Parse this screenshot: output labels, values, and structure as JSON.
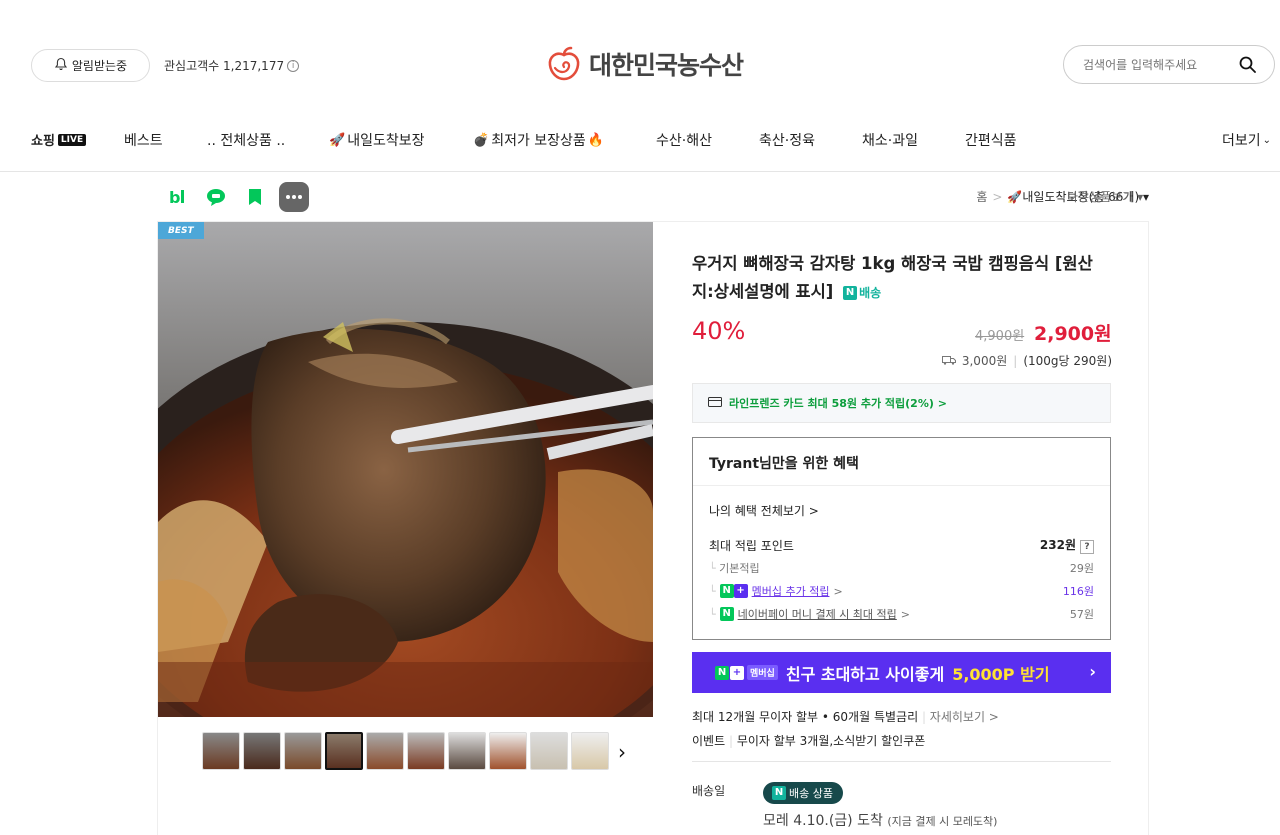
{
  "header": {
    "alarm_label": "알림받는중",
    "fans_label": "관심고객수 1,217,177",
    "logo_text": "대한민국농수산",
    "search_placeholder": "검색어를 입력해주세요"
  },
  "nav": {
    "items": [
      {
        "label": "쇼핑"
      },
      {
        "label": "베스트"
      },
      {
        "label": ".. 전체상품 .."
      },
      {
        "label": "내일도착보장"
      },
      {
        "label": "최저가 보장상품"
      },
      {
        "label": "수산·해산"
      },
      {
        "label": "축산·정육"
      },
      {
        "label": "채소·과일"
      },
      {
        "label": "간편식품"
      },
      {
        "label": "더보기"
      }
    ],
    "live_badge": "LIVE"
  },
  "breadcrumb": {
    "home": "홈",
    "category": "내일도착보장(총 66개)",
    "other": "다른상품보기"
  },
  "product": {
    "badge": "BEST",
    "title": "우거지 뼈해장국 감자탕 1kg 해장국 국밥 캠핑음식 [원산지:상세설명에 표시]",
    "delivery_badge": "배송",
    "discount": "40%",
    "original_price": "4,900원",
    "price": "2,900원",
    "shipping_fee": "3,000원",
    "unit_price": "(100g당 290원)",
    "card_benefit": "라인프렌즈 카드 최대 58원 추가 적립(2%) >",
    "benefit_title": "Tyrant님만을 위한 혜택",
    "my_benefit_link": "나의 혜택 전체보기 >",
    "max_points_label": "최대 적립 포인트",
    "max_points_value": "232원",
    "basic_label": "기본적립",
    "basic_value": "29원",
    "membership_label": "멤버십 추가 적립",
    "membership_value": "116원",
    "npay_label": "네이버페이 머니 결제 시 최대 적립",
    "npay_value": "57원",
    "promo_badge": "멤버십",
    "promo_text": "친구 초대하고 사이좋게",
    "promo_highlight": "5,000P 받기",
    "installment": "최대 12개월 무이자 할부 • 60개월 특별금리",
    "installment_more": "자세히보기 >",
    "event_label": "이벤트",
    "event_text": "무이자 할부 3개월,소식받기 할인쿠폰",
    "delivery_date_label": "배송일",
    "n_delivery": "배송 상품",
    "arrival": "모레 4.10.(금) 도착",
    "arrival_note": "(지금 결제 시 모레도착)"
  },
  "colors": {
    "accent_red": "#e01e3b",
    "naver_green": "#0d9e3d",
    "promo_purple": "#5a2ff0",
    "best_blue": "#4da7d8"
  }
}
